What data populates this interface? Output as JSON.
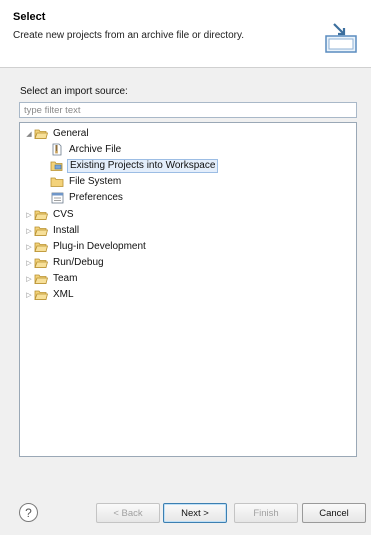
{
  "header": {
    "title": "Select",
    "description": "Create new projects from an archive file or directory."
  },
  "source_label": "Select an import source:",
  "filter": {
    "placeholder": "type filter text",
    "value": ""
  },
  "tree": {
    "general": "General",
    "archive_file": "Archive File",
    "existing_projects": "Existing Projects into Workspace",
    "file_system": "File System",
    "preferences": "Preferences",
    "cvs": "CVS",
    "install": "Install",
    "plugin_development": "Plug-in Development",
    "run_debug": "Run/Debug",
    "team": "Team",
    "xml": "XML"
  },
  "buttons": {
    "help": "?",
    "back": "< Back",
    "next": "Next >",
    "finish": "Finish",
    "cancel": "Cancel"
  },
  "icons": {
    "expanded": "triangle-down",
    "collapsed": "triangle-right"
  },
  "colors": {
    "folder": "#e8c060",
    "selection": "#e4eefb",
    "accent": "#3c7fb1"
  }
}
